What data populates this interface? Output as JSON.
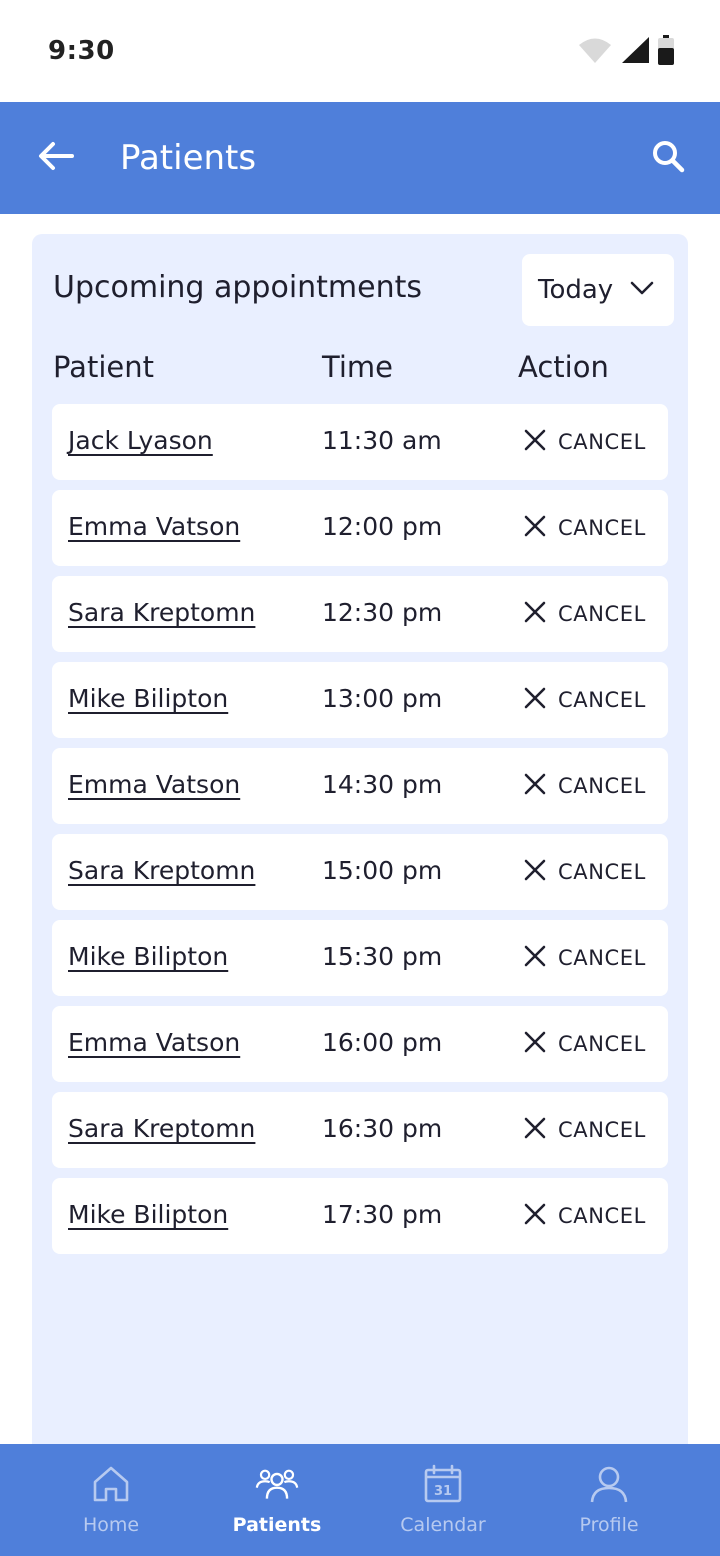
{
  "status_bar": {
    "time": "9:30",
    "icons": [
      "wifi-icon",
      "signal-icon",
      "battery-icon"
    ]
  },
  "app_bar": {
    "title": "Patients",
    "back_icon": "arrow-left-icon",
    "search_icon": "search-icon"
  },
  "appointments": {
    "title": "Upcoming appointments",
    "filter": {
      "selected": "Today",
      "icon": "chevron-down-icon"
    },
    "columns": [
      "Patient",
      "Time",
      "Action"
    ],
    "rows": [
      {
        "patient": "Jack Lyason",
        "time": "11:30 am",
        "action": "CANCEL"
      },
      {
        "patient": "Emma Vatson",
        "time": "12:00 pm",
        "action": "CANCEL"
      },
      {
        "patient": "Sara Kreptomn",
        "time": "12:30 pm",
        "action": "CANCEL"
      },
      {
        "patient": "Mike Bilipton",
        "time": "13:00 pm",
        "action": "CANCEL"
      },
      {
        "patient": "Emma Vatson",
        "time": "14:30 pm",
        "action": "CANCEL"
      },
      {
        "patient": "Sara Kreptomn",
        "time": "15:00 pm",
        "action": "CANCEL"
      },
      {
        "patient": "Mike Bilipton",
        "time": "15:30 pm",
        "action": "CANCEL"
      },
      {
        "patient": "Emma Vatson",
        "time": "16:00 pm",
        "action": "CANCEL"
      },
      {
        "patient": "Sara Kreptomn",
        "time": "16:30 pm",
        "action": "CANCEL"
      },
      {
        "patient": "Mike Bilipton",
        "time": "17:30 pm",
        "action": "CANCEL"
      }
    ]
  },
  "bottom_nav": {
    "items": [
      {
        "label": "Home",
        "icon": "home-icon",
        "active": false
      },
      {
        "label": "Patients",
        "icon": "patients-icon",
        "active": true
      },
      {
        "label": "Calendar",
        "icon": "calendar-icon",
        "active": false,
        "badge": "31"
      },
      {
        "label": "Profile",
        "icon": "profile-icon",
        "active": false
      }
    ]
  },
  "colors": {
    "primary": "#4f7fda",
    "panel_background": "#e9efff",
    "text": "#1f1f2e",
    "nav_inactive": "#b7caf0",
    "nav_active": "#ffffff"
  }
}
